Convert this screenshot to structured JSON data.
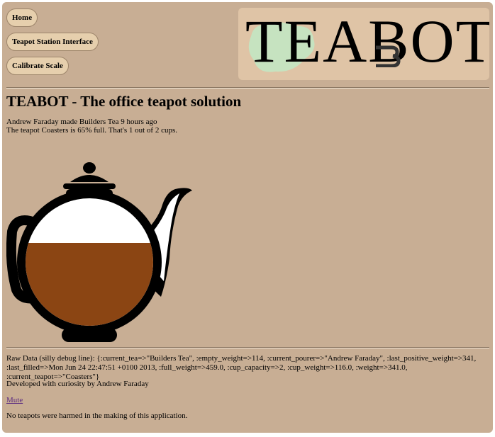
{
  "nav": {
    "home_label": "Home",
    "station_label": "Teapot Station Interface",
    "calibrate_label": "Calibrate Scale"
  },
  "logo": {
    "text": "TEABOT"
  },
  "heading": "TEABOT - The office teapot solution",
  "status": {
    "made_by": "Andrew Faraday made Builders Tea 9 hours ago",
    "fullness": "The teapot Coasters is 65% full. That's 1 out of 2 cups."
  },
  "teapot": {
    "name": "Coasters",
    "fill_fraction": 0.65,
    "tea_color": "#8b4513",
    "empty_color": "#ffffff",
    "outline_color": "#000000"
  },
  "raw_data": "Raw Data (silly debug line): {:current_tea=>\"Builders Tea\", :empty_weight=>114, :current_pourer=>\"Andrew Faraday\", :last_positive_weight=>341, :last_filled=>Mon Jun 24 22:47:51 +0100 2013, :full_weight=>459.0, :cup_capacity=>2, :cup_weight=>116.0, :weight=>341.0, :current_teapot=>\"Coasters\"}",
  "credit": "Developed with curiosity by Andrew Faraday",
  "mute_label": "Mute",
  "disclaimer": "No teapots were harmed in the making of this application.",
  "colors": {
    "page_bg": "#c8ae94",
    "button_bg": "#e6cfad",
    "logo_bg": "#dfc4a6",
    "logo_accent": "#c6e3c0",
    "link": "#5a2a80"
  }
}
